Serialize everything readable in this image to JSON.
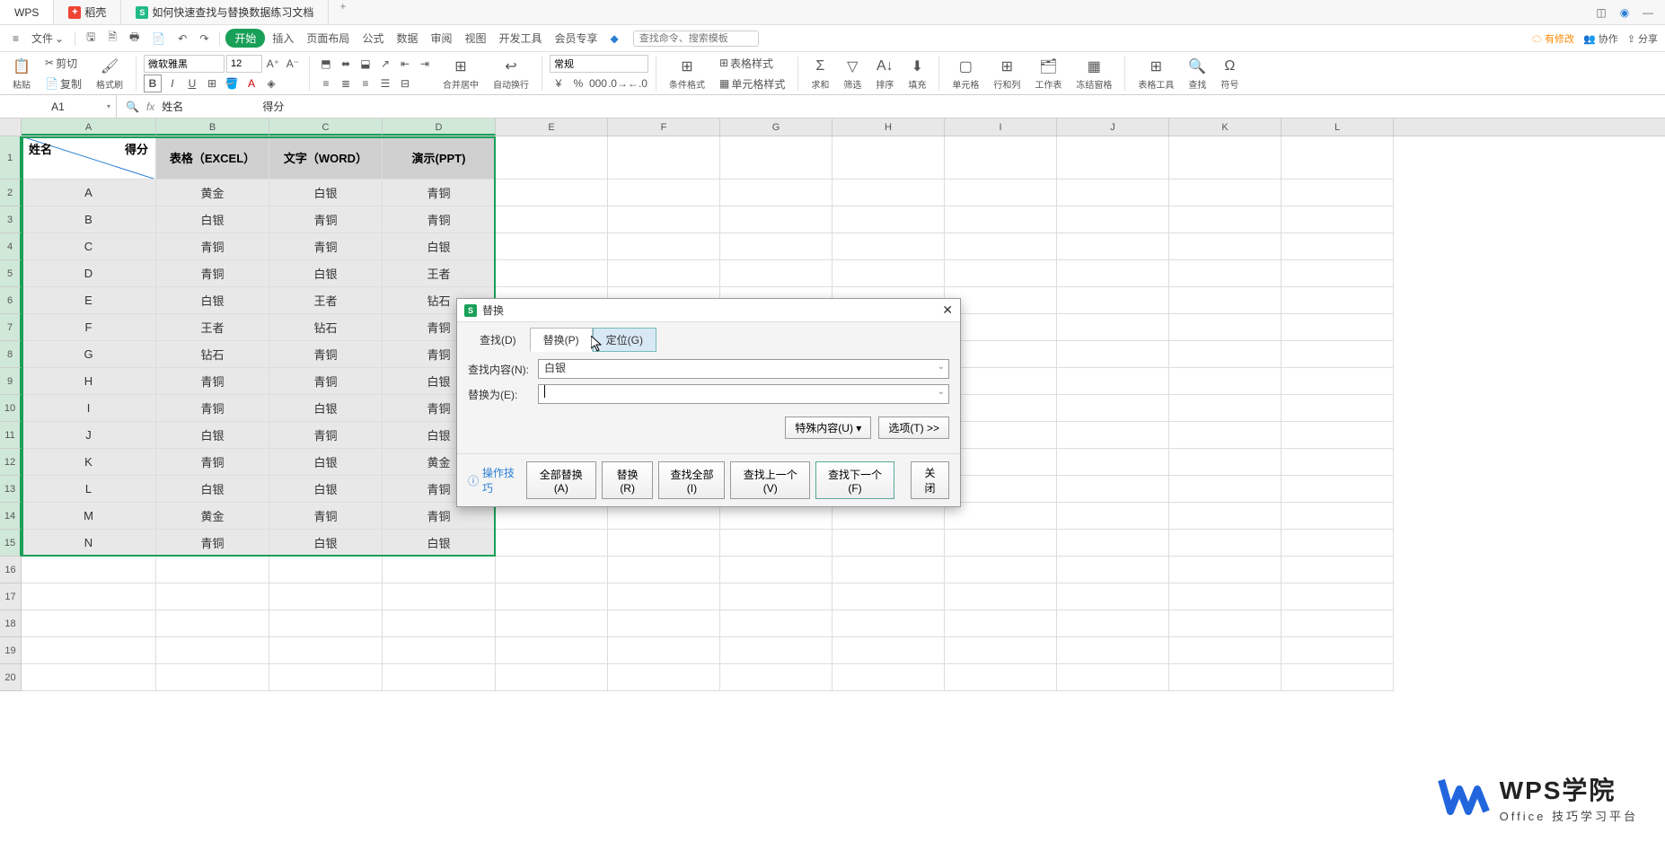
{
  "title_tabs": {
    "wps": "WPS",
    "daoke": "稻壳",
    "doc": "如何快速查找与替换数据练习文档"
  },
  "menu": {
    "file": "文件",
    "start": "开始",
    "insert": "插入",
    "layout": "页面布局",
    "formula": "公式",
    "data": "数据",
    "review": "审阅",
    "view": "视图",
    "devtools": "开发工具",
    "member": "会员专享",
    "search_ph": "查找命令、搜索模板",
    "right": {
      "changes": "有修改",
      "collab": "协作",
      "share": "分享"
    }
  },
  "ribbon": {
    "paste": "粘贴",
    "cut": "剪切",
    "copy": "复制",
    "painter": "格式刷",
    "font_name": "微软雅黑",
    "font_size": "12",
    "merge": "合并居中",
    "wrap": "自动换行",
    "general": "常规",
    "cond": "条件格式",
    "table_style": "表格样式",
    "cell_style": "单元格样式",
    "sum": "求和",
    "filter": "筛选",
    "sort": "排序",
    "fill": "填充",
    "cell": "单元格",
    "rowcol": "行和列",
    "worksheet": "工作表",
    "freeze": "冻结窗格",
    "tabletools": "表格工具",
    "find": "查找",
    "symbol": "符号"
  },
  "formula_bar": {
    "cell_ref": "A1",
    "content_a": "姓名",
    "content_b": "得分"
  },
  "columns": [
    "A",
    "B",
    "C",
    "D",
    "E",
    "F",
    "G",
    "H",
    "I",
    "J",
    "K",
    "L"
  ],
  "header_row": {
    "diag_name": "姓名",
    "diag_score": "得分",
    "b": "表格（EXCEL）",
    "c": "文字（WORD）",
    "d": "演示(PPT)"
  },
  "chart_data": {
    "type": "table",
    "columns": [
      "姓名",
      "表格（EXCEL）",
      "文字（WORD）",
      "演示(PPT)"
    ],
    "rows": [
      [
        "A",
        "黄金",
        "白银",
        "青铜"
      ],
      [
        "B",
        "白银",
        "青铜",
        "青铜"
      ],
      [
        "C",
        "青铜",
        "青铜",
        "白银"
      ],
      [
        "D",
        "青铜",
        "白银",
        "王者"
      ],
      [
        "E",
        "白银",
        "王者",
        "钻石"
      ],
      [
        "F",
        "王者",
        "钻石",
        "青铜"
      ],
      [
        "G",
        "钻石",
        "青铜",
        "青铜"
      ],
      [
        "H",
        "青铜",
        "青铜",
        "白银"
      ],
      [
        "I",
        "青铜",
        "白银",
        "青铜"
      ],
      [
        "J",
        "白银",
        "青铜",
        "白银"
      ],
      [
        "K",
        "青铜",
        "白银",
        "黄金"
      ],
      [
        "L",
        "白银",
        "白银",
        "青铜"
      ],
      [
        "M",
        "黄金",
        "青铜",
        "青铜"
      ],
      [
        "N",
        "青铜",
        "白银",
        "白银"
      ]
    ]
  },
  "dialog": {
    "title": "替换",
    "tabs": {
      "find": "查找(D)",
      "replace": "替换(P)",
      "goto": "定位(G)"
    },
    "find_label": "查找内容(N):",
    "find_value": "白银",
    "replace_label": "替换为(E):",
    "replace_value": "",
    "special": "特殊内容(U)",
    "options": "选项(T) >>",
    "tip": "操作技巧",
    "btn_replace_all": "全部替换(A)",
    "btn_replace": "替换(R)",
    "btn_find_all": "查找全部(I)",
    "btn_find_prev": "查找上一个(V)",
    "btn_find_next": "查找下一个(F)",
    "btn_close": "关闭"
  },
  "watermark": {
    "main": "WPS学院",
    "sub": "Office 技巧学习平台"
  }
}
